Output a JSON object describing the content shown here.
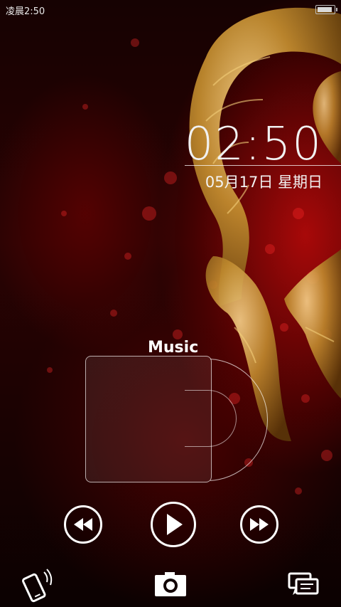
{
  "status_bar": {
    "time": "凌晨2:50",
    "battery_level": 0.9
  },
  "lockscreen": {
    "clock": "02:50",
    "date": "05月17日  星期日"
  },
  "music": {
    "title": "Music"
  },
  "controls": {
    "prev_icon": "rewind-icon",
    "play_icon": "play-icon",
    "next_icon": "fast-forward-icon"
  },
  "shortcuts": {
    "left_icon": "phone-icon",
    "center_icon": "camera-icon",
    "right_icon": "message-icon"
  },
  "colors": {
    "background_red": "#b00a0a",
    "dragon_gold": "#c08a2e",
    "foreground": "#ffffff"
  }
}
